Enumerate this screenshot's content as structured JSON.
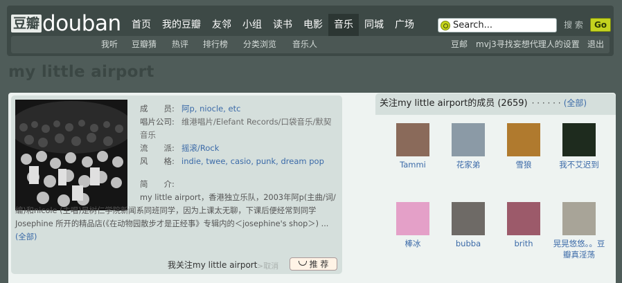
{
  "logo": {
    "cn": "豆瓣",
    "en": "douban"
  },
  "nav": {
    "items": [
      {
        "label": "首页"
      },
      {
        "label": "我的豆瓣"
      },
      {
        "label": "友邻"
      },
      {
        "label": "小组"
      },
      {
        "label": "读书"
      },
      {
        "label": "电影"
      },
      {
        "label": "音乐"
      },
      {
        "label": "同城"
      },
      {
        "label": "广场"
      }
    ],
    "active": "音乐"
  },
  "search": {
    "placeholder": "Search...",
    "label": "搜 索",
    "go": "Go"
  },
  "subnav": {
    "left": [
      "我听",
      "豆瓣猜",
      "热评",
      "排行榜",
      "分类浏览",
      "音乐人"
    ],
    "right": [
      "豆邮",
      "mvj3寻找妄想代理人的设置",
      "退出"
    ]
  },
  "page": {
    "title": "my little airport"
  },
  "info": {
    "rows": [
      {
        "label": "成　　员:",
        "value": "阿p, niocle, etc",
        "link": true
      },
      {
        "label": "唱片公司:",
        "value": "维港唱片/Elefant Records/口袋音乐/默契",
        "link": false
      },
      {
        "label": "",
        "value": "音乐",
        "link": false
      },
      {
        "label": "流　　派:",
        "value": "摇滚/Rock",
        "link": true
      },
      {
        "label": "风　　格:",
        "value": "indie, twee, casio, punk, dream pop",
        "link": true
      }
    ],
    "intro_label": "简　　介:",
    "intro_text": "my little airport，香港独立乐队，2003年阿p(主曲/词/编)和nicole (主唱)是树仁学院新闻系同班同学，因为上课太无聊，下课后便经常到同学Josephine 所开的精品店(《在动物园散步才是正经事》专辑内的＜josephine's shop＞) ...",
    "intro_more": "(全部)",
    "follow_text": "我关注my little airport",
    "cancel": ">取消",
    "recommend": "推 荐"
  },
  "members": {
    "heading": "关注my little airport的成员 (2659)",
    "dots": "· · · · · ·",
    "all_link": "(全部)",
    "list": [
      {
        "name": "Tammi",
        "color": "#8a6a5a"
      },
      {
        "name": "花家弟",
        "color": "#8b9aa6"
      },
      {
        "name": "雪狼",
        "color": "#b07a2e"
      },
      {
        "name": "我不艾迟到",
        "color": "#1e2b1e"
      },
      {
        "name": "棒冰",
        "color": "#e4a0c8"
      },
      {
        "name": "bubba",
        "color": "#6e6a66"
      },
      {
        "name": "brith",
        "color": "#9c5a6a"
      },
      {
        "name": "晃晃悠悠。。豆瓣真淫荡",
        "color": "#a8a498"
      }
    ]
  }
}
